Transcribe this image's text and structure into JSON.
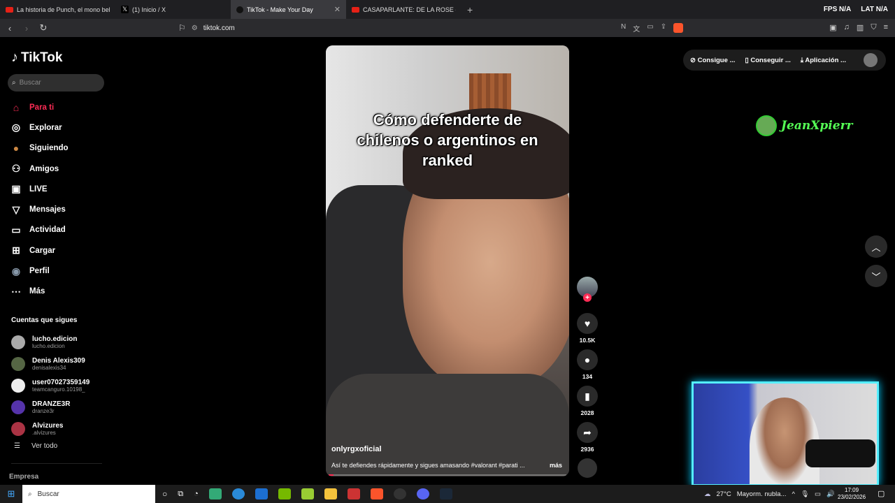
{
  "browser": {
    "tabs": [
      {
        "title": "La historia de Punch, el mono bebé,",
        "favicon_color": "#e62117",
        "active": false
      },
      {
        "title": "(1) Inicio / X",
        "favicon_color": "#000000",
        "active": false
      },
      {
        "title": "TikTok - Make Your Day",
        "favicon_color": "#111111",
        "active": true
      },
      {
        "title": "CASAPARLANTE: DE LA ROSE - YouTu",
        "favicon_color": "#e62117",
        "active": false
      }
    ],
    "close_icon": "✕",
    "new_tab": "+",
    "fps_label": "FPS",
    "fps_value": "N/A",
    "lat_label": "LAT",
    "lat_value": "N/A",
    "url": "tiktok.com"
  },
  "sidebar": {
    "logo": "TikTok",
    "search_placeholder": "Buscar",
    "nav": [
      {
        "label": "Para ti",
        "icon": "home-icon",
        "glyph": "⌂"
      },
      {
        "label": "Explorar",
        "icon": "compass-icon",
        "glyph": "◎"
      },
      {
        "label": "Siguiendo",
        "icon": "following-icon",
        "glyph": "●"
      },
      {
        "label": "Amigos",
        "icon": "friends-icon",
        "glyph": "⚇"
      },
      {
        "label": "LIVE",
        "icon": "live-icon",
        "glyph": "▣"
      },
      {
        "label": "Mensajes",
        "icon": "messages-icon",
        "glyph": "▽"
      },
      {
        "label": "Actividad",
        "icon": "activity-icon",
        "glyph": "▭"
      },
      {
        "label": "Cargar",
        "icon": "upload-icon",
        "glyph": "⊞"
      },
      {
        "label": "Perfil",
        "icon": "profile-icon",
        "glyph": "◉"
      },
      {
        "label": "Más",
        "icon": "more-icon",
        "glyph": "⋯"
      }
    ],
    "following_title": "Cuentas que sigues",
    "following": [
      {
        "name": "lucho.edicion",
        "handle": "lucho.edicion",
        "color": "#aaaaaa"
      },
      {
        "name": "Denis Alexis309",
        "handle": "denisalexis34",
        "color": "#556644"
      },
      {
        "name": "user07027359149",
        "handle": "teamcanguro.10198_",
        "color": "#eeeeee"
      },
      {
        "name": "DRANZE3R",
        "handle": "dranze3r",
        "color": "#5533aa"
      },
      {
        "name": "Alvizures",
        "handle": ".alvizures",
        "color": "#aa3344"
      }
    ],
    "see_all": "Ver todo",
    "company": "Empresa"
  },
  "video": {
    "caption": "Cómo defenderte de chilenos o argentinos en ranked",
    "author": "onlyrgxoficial",
    "description": "Así te defiendes rápidamente y sigues amasando #valorant #parati ...",
    "more": "más",
    "progress_fraction": 0.02
  },
  "actions": {
    "likes": "10.5K",
    "comments": "134",
    "saves": "2028",
    "shares": "2936"
  },
  "header": {
    "coins": "Consigue ...",
    "app": "Conseguir ...",
    "download": "Aplicación ..."
  },
  "overlay": {
    "streamer_name": "JeanXpierr"
  },
  "taskbar": {
    "search": "Buscar",
    "temperature": "27°C",
    "weather": "Mayorm. nubla...",
    "time": "17:09",
    "date": "23/02/2026"
  }
}
